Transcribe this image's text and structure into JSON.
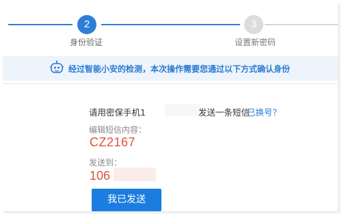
{
  "steps": [
    {
      "number": "2",
      "label": "身份验证",
      "active": true
    },
    {
      "number": "3",
      "label": "设置新密码",
      "active": false
    }
  ],
  "notice": {
    "icon": "robot-icon",
    "text": "经过智能小安的检测，本次操作需要您通过以下方式确认身份"
  },
  "sms": {
    "prefix": "请用密保手机1",
    "suffix": "发送一条短信",
    "change_link": "已换号？",
    "edit_label": "编辑短信内容：",
    "code": "CZ2167",
    "send_to_label": "发送到：",
    "number": "106",
    "button": "我已发送"
  },
  "colors": {
    "accent": "#2c7fd6",
    "highlight": "#e0533a",
    "notice_bg": "#eef4fb"
  }
}
